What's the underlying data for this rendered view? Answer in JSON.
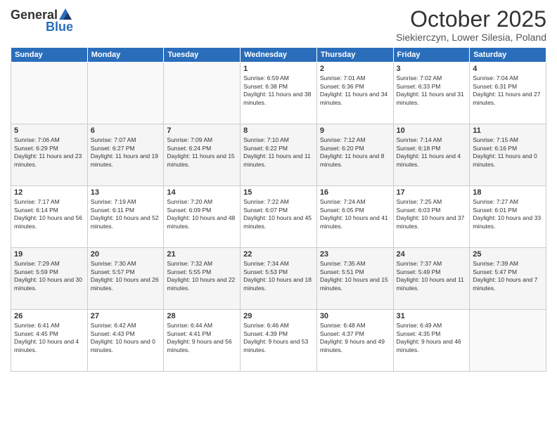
{
  "logo": {
    "general": "General",
    "blue": "Blue"
  },
  "header": {
    "month": "October 2025",
    "location": "Siekierczyn, Lower Silesia, Poland"
  },
  "days_of_week": [
    "Sunday",
    "Monday",
    "Tuesday",
    "Wednesday",
    "Thursday",
    "Friday",
    "Saturday"
  ],
  "weeks": [
    [
      {
        "day": "",
        "sunrise": "",
        "sunset": "",
        "daylight": ""
      },
      {
        "day": "",
        "sunrise": "",
        "sunset": "",
        "daylight": ""
      },
      {
        "day": "",
        "sunrise": "",
        "sunset": "",
        "daylight": ""
      },
      {
        "day": "1",
        "sunrise": "Sunrise: 6:59 AM",
        "sunset": "Sunset: 6:38 PM",
        "daylight": "Daylight: 11 hours and 38 minutes."
      },
      {
        "day": "2",
        "sunrise": "Sunrise: 7:01 AM",
        "sunset": "Sunset: 6:36 PM",
        "daylight": "Daylight: 11 hours and 34 minutes."
      },
      {
        "day": "3",
        "sunrise": "Sunrise: 7:02 AM",
        "sunset": "Sunset: 6:33 PM",
        "daylight": "Daylight: 11 hours and 31 minutes."
      },
      {
        "day": "4",
        "sunrise": "Sunrise: 7:04 AM",
        "sunset": "Sunset: 6:31 PM",
        "daylight": "Daylight: 11 hours and 27 minutes."
      }
    ],
    [
      {
        "day": "5",
        "sunrise": "Sunrise: 7:06 AM",
        "sunset": "Sunset: 6:29 PM",
        "daylight": "Daylight: 11 hours and 23 minutes."
      },
      {
        "day": "6",
        "sunrise": "Sunrise: 7:07 AM",
        "sunset": "Sunset: 6:27 PM",
        "daylight": "Daylight: 11 hours and 19 minutes."
      },
      {
        "day": "7",
        "sunrise": "Sunrise: 7:09 AM",
        "sunset": "Sunset: 6:24 PM",
        "daylight": "Daylight: 11 hours and 15 minutes."
      },
      {
        "day": "8",
        "sunrise": "Sunrise: 7:10 AM",
        "sunset": "Sunset: 6:22 PM",
        "daylight": "Daylight: 11 hours and 11 minutes."
      },
      {
        "day": "9",
        "sunrise": "Sunrise: 7:12 AM",
        "sunset": "Sunset: 6:20 PM",
        "daylight": "Daylight: 11 hours and 8 minutes."
      },
      {
        "day": "10",
        "sunrise": "Sunrise: 7:14 AM",
        "sunset": "Sunset: 6:18 PM",
        "daylight": "Daylight: 11 hours and 4 minutes."
      },
      {
        "day": "11",
        "sunrise": "Sunrise: 7:15 AM",
        "sunset": "Sunset: 6:16 PM",
        "daylight": "Daylight: 11 hours and 0 minutes."
      }
    ],
    [
      {
        "day": "12",
        "sunrise": "Sunrise: 7:17 AM",
        "sunset": "Sunset: 6:14 PM",
        "daylight": "Daylight: 10 hours and 56 minutes."
      },
      {
        "day": "13",
        "sunrise": "Sunrise: 7:19 AM",
        "sunset": "Sunset: 6:11 PM",
        "daylight": "Daylight: 10 hours and 52 minutes."
      },
      {
        "day": "14",
        "sunrise": "Sunrise: 7:20 AM",
        "sunset": "Sunset: 6:09 PM",
        "daylight": "Daylight: 10 hours and 48 minutes."
      },
      {
        "day": "15",
        "sunrise": "Sunrise: 7:22 AM",
        "sunset": "Sunset: 6:07 PM",
        "daylight": "Daylight: 10 hours and 45 minutes."
      },
      {
        "day": "16",
        "sunrise": "Sunrise: 7:24 AM",
        "sunset": "Sunset: 6:05 PM",
        "daylight": "Daylight: 10 hours and 41 minutes."
      },
      {
        "day": "17",
        "sunrise": "Sunrise: 7:25 AM",
        "sunset": "Sunset: 6:03 PM",
        "daylight": "Daylight: 10 hours and 37 minutes."
      },
      {
        "day": "18",
        "sunrise": "Sunrise: 7:27 AM",
        "sunset": "Sunset: 6:01 PM",
        "daylight": "Daylight: 10 hours and 33 minutes."
      }
    ],
    [
      {
        "day": "19",
        "sunrise": "Sunrise: 7:29 AM",
        "sunset": "Sunset: 5:59 PM",
        "daylight": "Daylight: 10 hours and 30 minutes."
      },
      {
        "day": "20",
        "sunrise": "Sunrise: 7:30 AM",
        "sunset": "Sunset: 5:57 PM",
        "daylight": "Daylight: 10 hours and 26 minutes."
      },
      {
        "day": "21",
        "sunrise": "Sunrise: 7:32 AM",
        "sunset": "Sunset: 5:55 PM",
        "daylight": "Daylight: 10 hours and 22 minutes."
      },
      {
        "day": "22",
        "sunrise": "Sunrise: 7:34 AM",
        "sunset": "Sunset: 5:53 PM",
        "daylight": "Daylight: 10 hours and 18 minutes."
      },
      {
        "day": "23",
        "sunrise": "Sunrise: 7:35 AM",
        "sunset": "Sunset: 5:51 PM",
        "daylight": "Daylight: 10 hours and 15 minutes."
      },
      {
        "day": "24",
        "sunrise": "Sunrise: 7:37 AM",
        "sunset": "Sunset: 5:49 PM",
        "daylight": "Daylight: 10 hours and 11 minutes."
      },
      {
        "day": "25",
        "sunrise": "Sunrise: 7:39 AM",
        "sunset": "Sunset: 5:47 PM",
        "daylight": "Daylight: 10 hours and 7 minutes."
      }
    ],
    [
      {
        "day": "26",
        "sunrise": "Sunrise: 6:41 AM",
        "sunset": "Sunset: 4:45 PM",
        "daylight": "Daylight: 10 hours and 4 minutes."
      },
      {
        "day": "27",
        "sunrise": "Sunrise: 6:42 AM",
        "sunset": "Sunset: 4:43 PM",
        "daylight": "Daylight: 10 hours and 0 minutes."
      },
      {
        "day": "28",
        "sunrise": "Sunrise: 6:44 AM",
        "sunset": "Sunset: 4:41 PM",
        "daylight": "Daylight: 9 hours and 56 minutes."
      },
      {
        "day": "29",
        "sunrise": "Sunrise: 6:46 AM",
        "sunset": "Sunset: 4:39 PM",
        "daylight": "Daylight: 9 hours and 53 minutes."
      },
      {
        "day": "30",
        "sunrise": "Sunrise: 6:48 AM",
        "sunset": "Sunset: 4:37 PM",
        "daylight": "Daylight: 9 hours and 49 minutes."
      },
      {
        "day": "31",
        "sunrise": "Sunrise: 6:49 AM",
        "sunset": "Sunset: 4:35 PM",
        "daylight": "Daylight: 9 hours and 46 minutes."
      },
      {
        "day": "",
        "sunrise": "",
        "sunset": "",
        "daylight": ""
      }
    ]
  ]
}
